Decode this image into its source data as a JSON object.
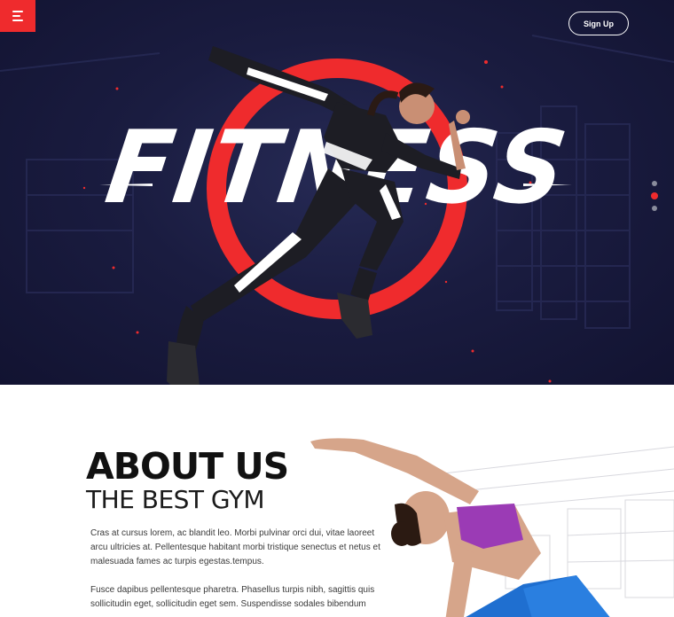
{
  "header": {
    "menu_icon": "hamburger-menu-icon",
    "signup_label": "Sign Up"
  },
  "hero": {
    "title": "FITNESS",
    "slides_count": 3,
    "active_slide": 2,
    "colors": {
      "accent": "#ef2b2d",
      "background": "#1a1c40"
    }
  },
  "about": {
    "heading": "ABOUT US",
    "subheading": "THE BEST GYM",
    "paragraph1": "Cras at cursus lorem, ac blandit leo. Morbi pulvinar orci dui, vitae laoreet arcu ultricies at. Pellentesque habitant morbi tristique senectus et netus et malesuada fames ac turpis egestas.tempus.",
    "paragraph2": "Fusce dapibus pellentesque pharetra. Phasellus turpis nibh, sagittis quis sollicitudin eget, sollicitudin eget sem. Suspendisse sodales bibendum"
  }
}
